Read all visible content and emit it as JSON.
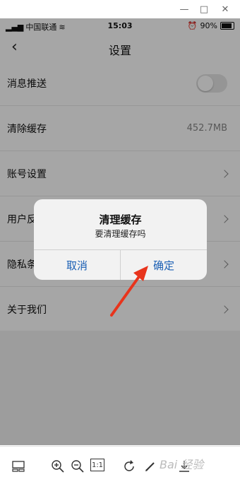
{
  "window": {
    "minimize": "—",
    "maximize": "□",
    "close": "✕"
  },
  "status": {
    "carrier": "中国联通",
    "time": "15:03",
    "battery": "90%"
  },
  "nav": {
    "title": "设置"
  },
  "settings": [
    {
      "label": "消息推送",
      "type": "toggle"
    },
    {
      "label": "清除缓存",
      "type": "value",
      "value": "452.7MB"
    },
    {
      "label": "账号设置",
      "type": "link"
    },
    {
      "label": "用户反",
      "type": "link"
    },
    {
      "label": "隐私条",
      "type": "link"
    },
    {
      "label": "关于我们",
      "type": "link"
    }
  ],
  "dialog": {
    "title": "清理缓存",
    "message": "要清理缓存吗",
    "cancel": "取消",
    "confirm": "确定"
  },
  "toolbar": {
    "actual_size": "1:1"
  },
  "watermark": "Bai 经验",
  "colors": {
    "accent": "#1a5fb4",
    "arrow": "#e8341c"
  }
}
